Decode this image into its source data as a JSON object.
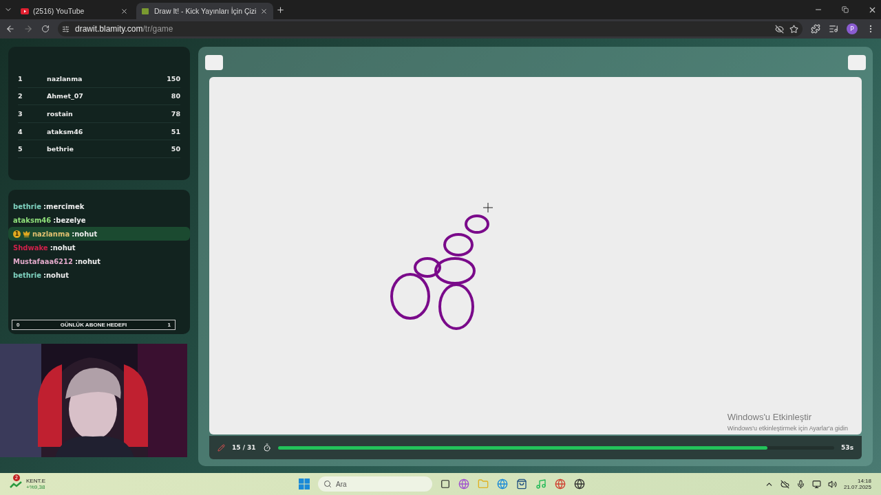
{
  "browser": {
    "tabs": [
      {
        "title": "(2516) YouTube",
        "selected": false
      },
      {
        "title": "Draw It! - Kick Yayınları İçin Çizi",
        "selected": true
      }
    ],
    "url": {
      "host": "drawit.blamity.com",
      "path": "/tr/game"
    },
    "profile": "P"
  },
  "leaderboard": [
    {
      "rank": "1",
      "name": "nazlanma",
      "score": "150"
    },
    {
      "rank": "2",
      "name": "Ahmet_07",
      "score": "80"
    },
    {
      "rank": "3",
      "name": "rostain",
      "score": "78"
    },
    {
      "rank": "4",
      "name": "ataksm46",
      "score": "51"
    },
    {
      "rank": "5",
      "name": "bethrie",
      "score": "50"
    }
  ],
  "chat": [
    {
      "user": "bethrie",
      "text": ":mercimek",
      "color": "#7fd3c0",
      "highlighted": false
    },
    {
      "user": "ataksm46",
      "text": ":bezelye",
      "color": "#8fe07a",
      "highlighted": false
    },
    {
      "user": "nazlanma",
      "text": ":nohut",
      "color": "#e0c070",
      "highlighted": true,
      "badge": "1"
    },
    {
      "user": "Shdwake",
      "text": ":nohut",
      "color": "#d0204a",
      "highlighted": false
    },
    {
      "user": "Mustafaaa6212",
      "text": ":nohut",
      "color": "#e0a8c8",
      "highlighted": false
    },
    {
      "user": "bethrie",
      "text": ":nohut",
      "color": "#7fd3c0",
      "highlighted": false
    }
  ],
  "goal": {
    "start": "0",
    "label": "GÜNLÜK ABONE HEDEFI",
    "end": "1"
  },
  "game": {
    "round": "15 / 31",
    "time": "53s",
    "level": 0.88
  },
  "activation": {
    "title": "Windows'u Etkinleştir",
    "hint": "Windows'u etkinleştirmek için Ayarlar'a gidin"
  },
  "taskbar": {
    "widget": {
      "badge": "2",
      "name": "KENT.E",
      "change": "+%9,38"
    },
    "search": {
      "placeholder": "Ara"
    },
    "time": "14:18",
    "date": "21.07.2025"
  }
}
